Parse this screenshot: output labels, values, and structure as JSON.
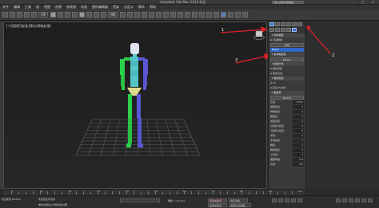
{
  "titlebar": {
    "title": "Autodesk 3ds Max 2018  双足",
    "search": "键入关键字或短语",
    "window_controls": "— □ ✕"
  },
  "menubar": {
    "items": [
      "文件",
      "编辑",
      "工具",
      "组",
      "视图",
      "创建",
      "修改器",
      "动画",
      "图形编辑器",
      "渲染",
      "自定义",
      "脚本",
      "帮助"
    ]
  },
  "toolbar": {
    "selection_set": "全部",
    "view_dropdown": "视图"
  },
  "viewport": {
    "label": "[+][透视][标准][默认明暗处理]"
  },
  "annotations": {
    "one": "1",
    "two": "2",
    "three": "3"
  },
  "command_panel": {
    "rows": [
      {
        "kind": "hdr",
        "text": "▾ 对象类型"
      },
      {
        "kind": "chk",
        "text": "自动栅格"
      },
      {
        "kind": "btn",
        "text": "骨骼"
      },
      {
        "kind": "sel",
        "text": "Biped"
      },
      {
        "kind": "hdr",
        "text": "▾ 名称和颜色"
      },
      {
        "kind": "btn",
        "text": "Bip001"
      },
      {
        "kind": "hdr",
        "text": "▾ 创建方法"
      },
      {
        "kind": "chk",
        "text": "拖动高度"
      },
      {
        "kind": "chk",
        "text": "拖动位置"
      },
      {
        "kind": "hdr",
        "text": "▾ 结构来源"
      },
      {
        "kind": "chk",
        "text": "U/I"
      },
      {
        "kind": "chk",
        "text": "最近.fig文件"
      },
      {
        "kind": "hdr",
        "text": "▾ 根名称"
      },
      {
        "kind": "btn",
        "text": "Bip001"
      },
      {
        "kind": "field",
        "text": "高度:",
        "value": "170.0"
      },
      {
        "kind": "field",
        "text": "颈部链接:",
        "value": "1"
      },
      {
        "kind": "field",
        "text": "脊椎链接:",
        "value": "4"
      },
      {
        "kind": "field",
        "text": "腿链接:",
        "value": "3"
      },
      {
        "kind": "field",
        "text": "尾部链接:",
        "value": "0"
      },
      {
        "kind": "field",
        "text": "马尾辫1链接:",
        "value": "0"
      },
      {
        "kind": "field",
        "text": "马尾辫2链接:",
        "value": "0"
      },
      {
        "kind": "field",
        "text": "手指:",
        "value": "1"
      },
      {
        "kind": "field",
        "text": "手指链接:",
        "value": "1"
      },
      {
        "kind": "field",
        "text": "脚趾:",
        "value": "1"
      },
      {
        "kind": "field",
        "text": "脚趾链接:",
        "value": "1"
      },
      {
        "kind": "field",
        "text": "小道具:",
        "value": "1"
      },
      {
        "kind": "field",
        "text": "踝部附着:",
        "value": "0.2"
      },
      {
        "kind": "field",
        "text": "高度:",
        "value": "0.0"
      }
    ]
  },
  "timeline": {
    "labels": [
      "0",
      "10",
      "20",
      "30",
      "40",
      "50",
      "60",
      "70",
      "80",
      "90",
      "100"
    ]
  },
  "status": {
    "maxscript": "欢迎使用 MAXScr",
    "message1": "未选定任何对象",
    "message2": "单击并拖动以开始创建过程",
    "grid": "栅格 = 10.0cm",
    "autokey": "自动关键点",
    "selected": "选定对象",
    "setkey": "设置关键点",
    "filters": "关键点过滤器..."
  },
  "colors": {
    "accent": "#3d6fbf",
    "biped_green": "#2bd14a",
    "biped_blue": "#5c58d8",
    "biped_cyan": "#53c7c7",
    "biped_yellow": "#e0d88c",
    "annotation_arrow": "#e0202a"
  }
}
